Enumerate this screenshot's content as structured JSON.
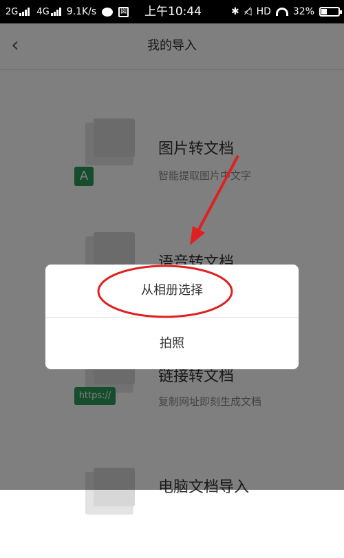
{
  "status_bar": {
    "sim1": "2G",
    "sim2": "4G",
    "speed": "9.1K/s",
    "app_icon_text": "図",
    "time": "上午10:44",
    "hd": "HD",
    "battery": "32%",
    "battery_level": 0.32
  },
  "header": {
    "back_icon": "chevron-left-icon",
    "title": "我的导入"
  },
  "items": [
    {
      "title": "图片转文档",
      "subtitle": "智能提取图片中文字",
      "badge": "A",
      "icon": "image-document-icon"
    },
    {
      "title": "语音转文档",
      "subtitle": "",
      "icon": "voice-document-icon"
    },
    {
      "title": "链接转文档",
      "subtitle": "复制网址即刻生成文档",
      "badge": "https://",
      "icon": "link-document-icon"
    },
    {
      "title": "电脑文档导入",
      "subtitle": "",
      "icon": "computer-document-icon"
    }
  ],
  "action_sheet": {
    "option_album": "从相册选择",
    "option_camera": "拍照"
  },
  "colors": {
    "accent_green": "#2a9b5b",
    "annotation_red": "#e02020"
  }
}
